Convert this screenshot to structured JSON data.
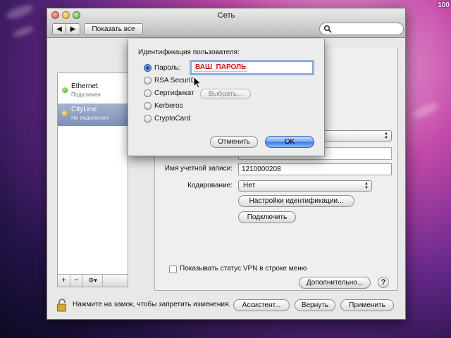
{
  "desktop": {
    "clock": "100"
  },
  "window": {
    "title": "Сеть",
    "nav_back": "◀",
    "nav_forward": "▶",
    "show_all": "Показать все",
    "search_placeholder": ""
  },
  "sidebar": {
    "services": [
      {
        "name": "Ethernet",
        "status": "Подключен",
        "status_color": "#2d9e12"
      },
      {
        "name": "CityLine",
        "status": "Не подключен",
        "status_color": "#d49b0a"
      }
    ],
    "add": "+",
    "remove": "−",
    "actions": "⚙▾"
  },
  "detail": {
    "account_label": "Имя учетной записи:",
    "account_value": "1210000208",
    "encoding_label": "Кодирование:",
    "encoding_value": "Нет",
    "auth_settings": "Настройки идентификации...",
    "connect": "Подключить",
    "show_vpn": "Показывать статус VPN в строке меню",
    "advanced": "Дополнительно...",
    "help": "?"
  },
  "bottom": {
    "lock_text": "Нажмите на замок, чтобы запретить изменения.",
    "assistant": "Ассистент...",
    "revert": "Вернуть",
    "apply": "Применить"
  },
  "sheet": {
    "title": "Идентификация пользователя:",
    "options": [
      "Пароль:",
      "RSA SecurID",
      "Сертификат",
      "Kerberos",
      "CryptoCard"
    ],
    "selected": "Пароль:",
    "password_value": "ВАШ_ПАРОЛЬ",
    "choose": "Выбрать...",
    "cancel": "Отменить",
    "ok": "OK"
  },
  "colors": {
    "accent": "#3f7de6",
    "password_text": "#e21010",
    "selection": "#7c8fb5"
  }
}
